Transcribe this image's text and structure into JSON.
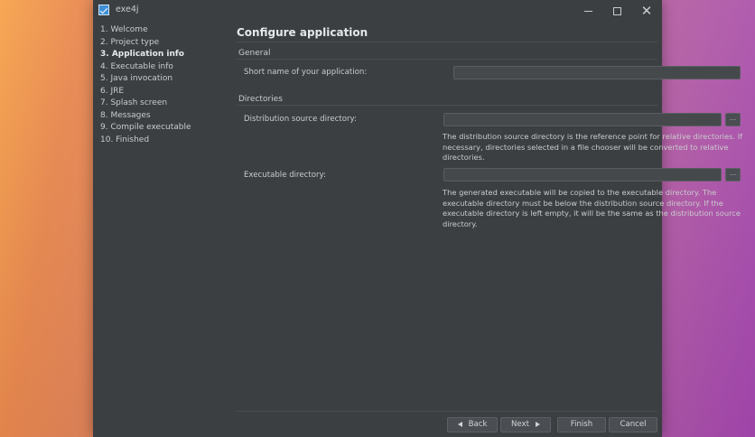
{
  "window": {
    "title": "exe4j"
  },
  "sidebar": {
    "items": [
      {
        "label": "1. Welcome"
      },
      {
        "label": "2. Project type"
      },
      {
        "label": "3. Application info",
        "active": true
      },
      {
        "label": "4. Executable info"
      },
      {
        "label": "5. Java invocation"
      },
      {
        "label": "6. JRE"
      },
      {
        "label": "7. Splash screen"
      },
      {
        "label": "8. Messages"
      },
      {
        "label": "9. Compile executable"
      },
      {
        "label": "10. Finished"
      }
    ]
  },
  "main": {
    "title": "Configure application",
    "general": {
      "heading": "General",
      "short_name_label": "Short name of your application:",
      "short_name_value": ""
    },
    "directories": {
      "heading": "Directories",
      "dist_label": "Distribution source directory:",
      "dist_value": "",
      "dist_help": "The distribution source directory is the reference point for relative directories. If necessary, directories selected in a file chooser will be converted to relative directories.",
      "exe_label": "Executable directory:",
      "exe_value": "",
      "exe_help": "The generated executable will be copied to the executable directory. The executable directory must be below the distribution source directory. If the executable directory is left empty, it will be the same as the distribution source directory.",
      "browse_label": "..."
    }
  },
  "footer": {
    "back": "Back",
    "next": "Next",
    "finish": "Finish",
    "cancel": "Cancel"
  },
  "icons": {
    "app": "exe4j-app-icon",
    "minimize": "minimize-icon",
    "maximize": "maximize-icon",
    "close": "close-icon"
  },
  "colors": {
    "window_bg": "#3b3f42",
    "field_bg": "#45494c",
    "text": "#d3d5d7"
  }
}
